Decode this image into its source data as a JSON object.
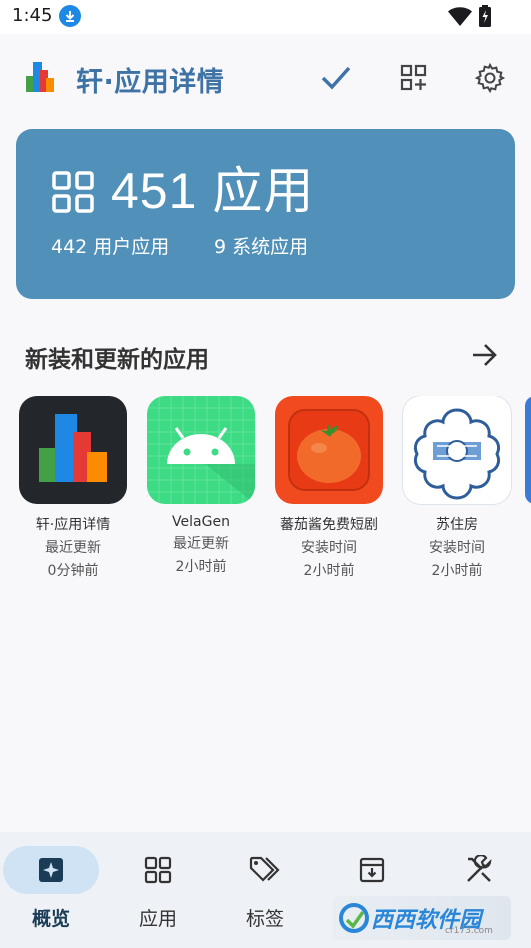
{
  "status_bar": {
    "time": "1:45"
  },
  "app_bar": {
    "title": "轩·应用详情"
  },
  "stats": {
    "total": "451 应用",
    "user_apps": "442 用户应用",
    "system_apps": "9 系统应用"
  },
  "section": {
    "title": "新装和更新的应用"
  },
  "recent_apps": [
    {
      "name": "轩·应用详情",
      "status": "最近更新",
      "time": "0分钟前",
      "icon": "app-details-logo"
    },
    {
      "name": "VelaGen",
      "status": "最近更新",
      "time": "2小时前",
      "icon": "android-icon"
    },
    {
      "name": "蕃茄酱免费短剧",
      "status": "安装时间",
      "time": "2小时前",
      "icon": "tomato-icon"
    },
    {
      "name": "苏住房",
      "status": "安装时间",
      "time": "2小时前",
      "icon": "building-emblem-icon"
    }
  ],
  "bottom_nav": [
    {
      "label": "概览",
      "icon": "sparkle-icon",
      "active": true
    },
    {
      "label": "应用",
      "icon": "grid-icon",
      "active": false
    },
    {
      "label": "标签",
      "icon": "tags-icon",
      "active": false
    },
    {
      "label": "",
      "icon": "archive-icon",
      "active": false
    },
    {
      "label": "",
      "icon": "tools-icon",
      "active": false
    }
  ],
  "watermark": {
    "text": "西西软件园",
    "sub": "cr173.com"
  },
  "colors": {
    "accent": "#3f73a6",
    "card": "#5190b8",
    "nav_active_pill": "#cfe3f5",
    "background": "#f8f8fb"
  }
}
